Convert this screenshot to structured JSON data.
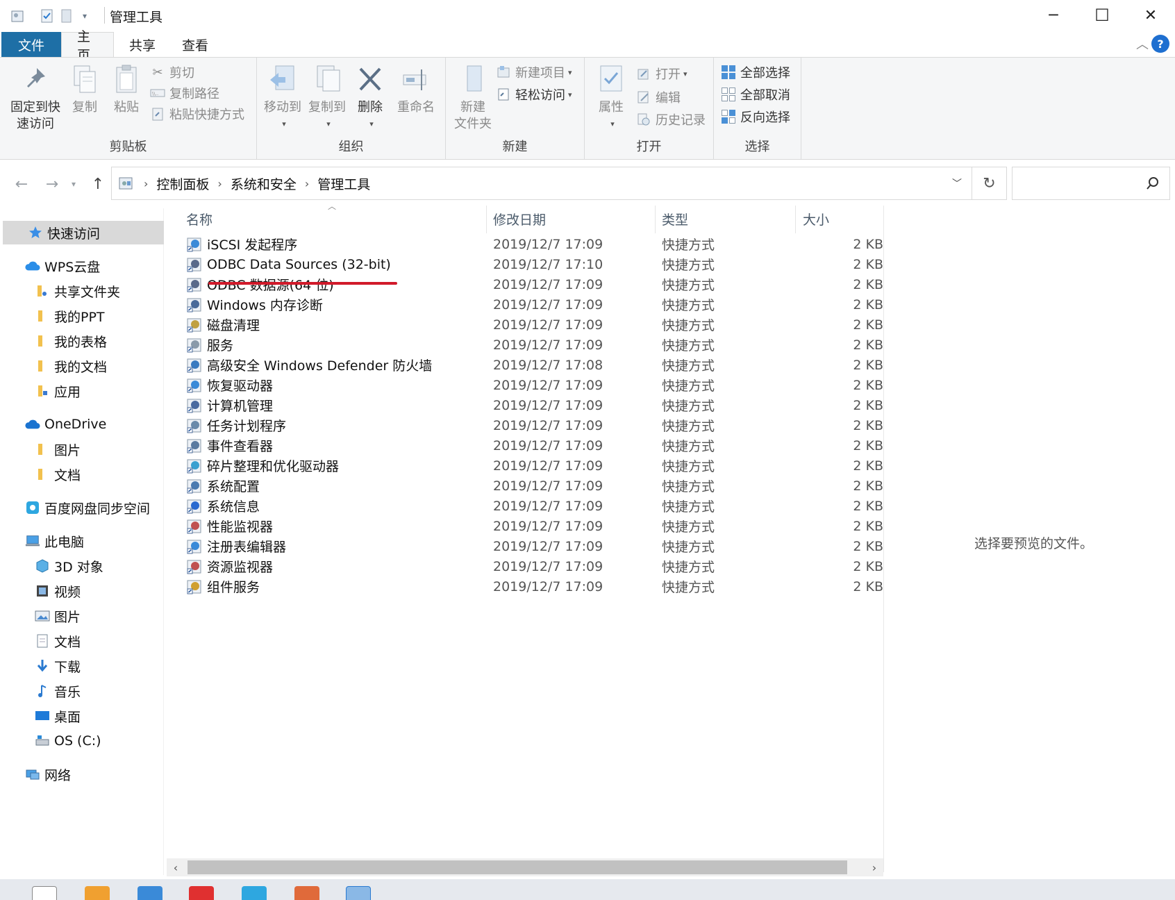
{
  "window": {
    "title": "管理工具",
    "minimize": "─",
    "maximize": "☐",
    "close": "✕"
  },
  "ribbon_tabs": {
    "file": "文件",
    "home": "主页",
    "share": "共享",
    "view": "查看"
  },
  "ribbon": {
    "clipboard": {
      "label": "剪贴板",
      "pin": "固定到快速访问",
      "pin_line1": "固定到快",
      "pin_line2": "速访问",
      "copy": "复制",
      "paste": "粘贴",
      "cut": "剪切",
      "copy_path": "复制路径",
      "paste_shortcut": "粘贴快捷方式"
    },
    "organize": {
      "label": "组织",
      "move_to": "移动到",
      "copy_to": "复制到",
      "delete": "删除",
      "rename": "重命名"
    },
    "new": {
      "label": "新建",
      "new_folder_line1": "新建",
      "new_folder_line2": "文件夹",
      "new_item": "新建项目",
      "easy_access": "轻松访问"
    },
    "open": {
      "label": "打开",
      "properties": "属性",
      "open": "打开",
      "edit": "编辑",
      "history": "历史记录"
    },
    "select": {
      "label": "选择",
      "select_all": "全部选择",
      "select_none": "全部取消",
      "invert": "反向选择"
    }
  },
  "address": {
    "crumbs": [
      "控制面板",
      "系统和安全",
      "管理工具"
    ],
    "search_placeholder": ""
  },
  "nav_pane": {
    "quick_access": "快速访问",
    "wps": "WPS云盘",
    "wps_items": [
      "共享文件夹",
      "我的PPT",
      "我的表格",
      "我的文档",
      "应用"
    ],
    "onedrive": "OneDrive",
    "onedrive_items": [
      "图片",
      "文档"
    ],
    "baidu": "百度网盘同步空间",
    "this_pc": "此电脑",
    "pc_items": [
      "3D 对象",
      "视频",
      "图片",
      "文档",
      "下载",
      "音乐",
      "桌面",
      "OS (C:)"
    ],
    "network": "网络"
  },
  "columns": {
    "name": "名称",
    "date": "修改日期",
    "type": "类型",
    "size": "大小"
  },
  "files": [
    {
      "name": "iSCSI 发起程序",
      "date": "2019/12/7 17:09",
      "type": "快捷方式",
      "size": "2 KB"
    },
    {
      "name": "ODBC Data Sources (32-bit)",
      "date": "2019/12/7 17:10",
      "type": "快捷方式",
      "size": "2 KB"
    },
    {
      "name": "ODBC 数据源(64 位)",
      "date": "2019/12/7 17:09",
      "type": "快捷方式",
      "size": "2 KB"
    },
    {
      "name": "Windows 内存诊断",
      "date": "2019/12/7 17:09",
      "type": "快捷方式",
      "size": "2 KB"
    },
    {
      "name": "磁盘清理",
      "date": "2019/12/7 17:09",
      "type": "快捷方式",
      "size": "2 KB"
    },
    {
      "name": "服务",
      "date": "2019/12/7 17:09",
      "type": "快捷方式",
      "size": "2 KB"
    },
    {
      "name": "高级安全 Windows Defender 防火墙",
      "date": "2019/12/7 17:08",
      "type": "快捷方式",
      "size": "2 KB"
    },
    {
      "name": "恢复驱动器",
      "date": "2019/12/7 17:09",
      "type": "快捷方式",
      "size": "2 KB"
    },
    {
      "name": "计算机管理",
      "date": "2019/12/7 17:09",
      "type": "快捷方式",
      "size": "2 KB"
    },
    {
      "name": "任务计划程序",
      "date": "2019/12/7 17:09",
      "type": "快捷方式",
      "size": "2 KB"
    },
    {
      "name": "事件查看器",
      "date": "2019/12/7 17:09",
      "type": "快捷方式",
      "size": "2 KB"
    },
    {
      "name": "碎片整理和优化驱动器",
      "date": "2019/12/7 17:09",
      "type": "快捷方式",
      "size": "2 KB"
    },
    {
      "name": "系统配置",
      "date": "2019/12/7 17:09",
      "type": "快捷方式",
      "size": "2 KB"
    },
    {
      "name": "系统信息",
      "date": "2019/12/7 17:09",
      "type": "快捷方式",
      "size": "2 KB"
    },
    {
      "name": "性能监视器",
      "date": "2019/12/7 17:09",
      "type": "快捷方式",
      "size": "2 KB"
    },
    {
      "name": "注册表编辑器",
      "date": "2019/12/7 17:09",
      "type": "快捷方式",
      "size": "2 KB"
    },
    {
      "name": "资源监视器",
      "date": "2019/12/7 17:09",
      "type": "快捷方式",
      "size": "2 KB"
    },
    {
      "name": "组件服务",
      "date": "2019/12/7 17:09",
      "type": "快捷方式",
      "size": "2 KB"
    }
  ],
  "preview": {
    "message": "选择要预览的文件。"
  },
  "colors": {
    "file_tab": "#1e6fa6",
    "highlight_underline": "#d11a2a",
    "selected_nav": "#d9d9d9"
  }
}
